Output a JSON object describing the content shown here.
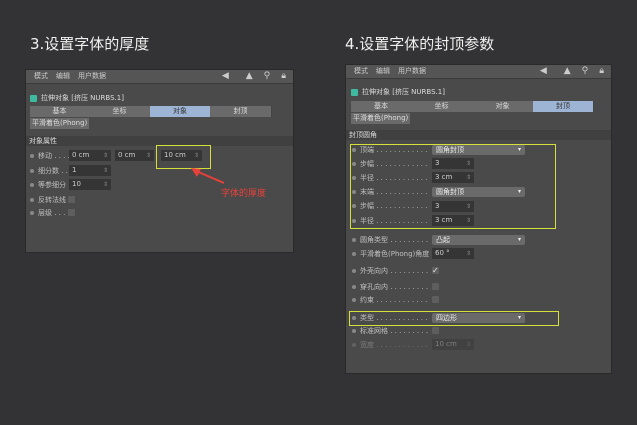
{
  "left": {
    "heading": "3.设置字体的厚度",
    "menu": [
      "模式",
      "编辑",
      "用户数据"
    ],
    "object_title": "拉伸对象 [挤压 NURBS.1]",
    "tabs": [
      "基本",
      "坐标",
      "对象",
      "封顶"
    ],
    "active_tab": "对象",
    "phong_tab": "平滑着色(Phong)",
    "section": "对象属性",
    "rows": [
      {
        "label": "移动 . . . .",
        "values": [
          "0 cm",
          "0 cm",
          "10 cm"
        ]
      },
      {
        "label": "细分数 . .",
        "value": "1"
      },
      {
        "label": "等参细分",
        "value": "10"
      },
      {
        "label": "反转法线",
        "checked": false
      },
      {
        "label": "层级 . . . .",
        "checked": false
      }
    ],
    "annotation": "字体的厚度"
  },
  "right": {
    "heading": "4.设置字体的封顶参数",
    "menu": [
      "模式",
      "编辑",
      "用户数据"
    ],
    "object_title": "拉伸对象 [挤压 NURBS.1]",
    "tabs": [
      "基本",
      "坐标",
      "对象",
      "封顶"
    ],
    "active_tab": "封顶",
    "phong_tab": "平滑着色(Phong)",
    "section": "封顶圆角",
    "rows": [
      {
        "label": "顶端 . . . . . . . . . . . .",
        "value": "圆角封顶"
      },
      {
        "label": "步幅 . . . . . . . . . . . .",
        "value": "3"
      },
      {
        "label": "半径 . . . . . . . . . . . .",
        "value": "3 cm"
      },
      {
        "label": "末端 . . . . . . . . . . . .",
        "value": "圆角封顶"
      },
      {
        "label": "步幅 . . . . . . . . . . . .",
        "value": "3"
      },
      {
        "label": "半径 . . . . . . . . . . . .",
        "value": "3 cm"
      },
      {
        "label": "圆角类型 . . . . . . . . .",
        "value": "凸起"
      },
      {
        "label": "平滑着色(Phong)角度",
        "value": "60 °"
      },
      {
        "label": "外壳向内 . . . . . . . . .",
        "checked": true
      },
      {
        "label": "穿孔向内 . . . . . . . . .",
        "checked": false
      },
      {
        "label": "约束 . . . . . . . . . . . .",
        "checked": false
      },
      {
        "label": "类型 . . . . . . . . . . . .",
        "value": "四边形"
      },
      {
        "label": "标准网格 . . . . . . . . .",
        "checked": false
      },
      {
        "label": "宽度 . . . . . . . . . . . .",
        "value": "10 cm"
      }
    ]
  },
  "colors": {
    "highlight": "#d6e03a",
    "annotation": "#e8403a",
    "active_tab": "#9db4d4"
  }
}
